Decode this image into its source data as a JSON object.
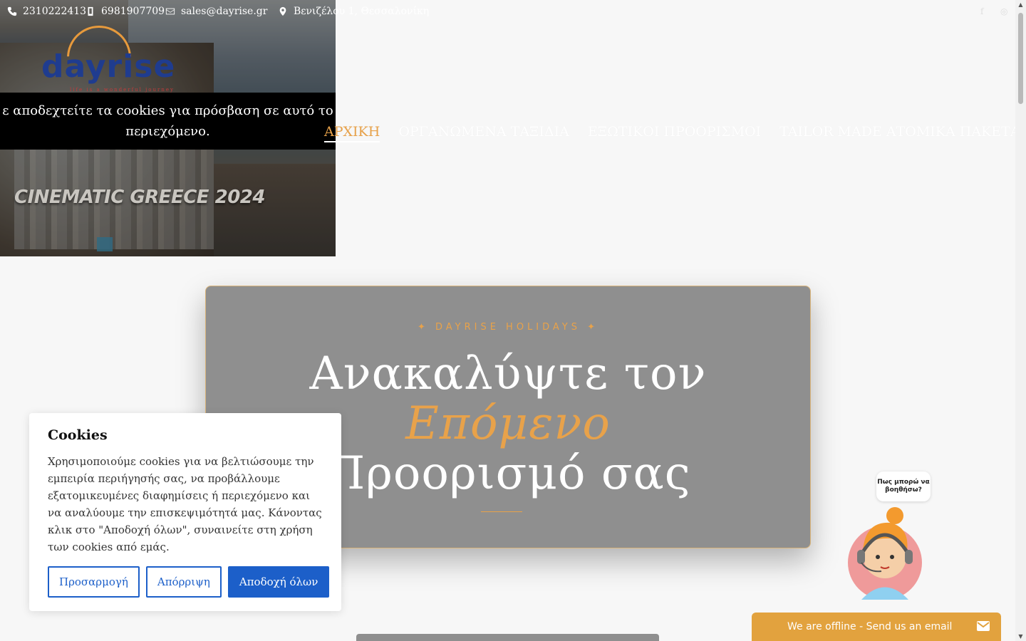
{
  "topbar": {
    "phone1": "2310222413",
    "phone2": "6981907709",
    "email": "sales@dayrise.gr",
    "address": "Βενιζέλου 1, Θεσσαλονίκη"
  },
  "logo": {
    "text": "dayrise",
    "tagline": "life is a wonderful journey"
  },
  "video": {
    "caption": "CINEMATIC GREECE 2024",
    "cookie_notice_line1": "ε αποδεχτείτε τα cookies για πρόσβαση σε αυτό το",
    "cookie_notice_line2": "περιεχόμενο."
  },
  "nav": {
    "items": [
      "ΑΡΧΙΚΗ",
      "ΟΡΓΑΝΩΜΕΝΑ ΤΑΞΙΔΙΑ",
      "ΕΞΩΤΙΚΟΙ ΠΡΟΟΡΙΣΜΟΙ",
      "TAILOR MADE ΑΤΟΜΙΚΑ ΠΑΚΕΤΑ"
    ],
    "active": "ΑΡΧΙΚΗ"
  },
  "hero": {
    "kicker": "✦ DAYRISE HOLIDAYS ✦",
    "line1": "Ανακαλύψτε τον",
    "line2": "Επόμενο",
    "line3": "Προορισμό σας"
  },
  "consent": {
    "title": "Cookies",
    "body": "Χρησιμοποιούμε cookies για να βελτιώσουμε την εμπειρία περιήγησής σας, να προβάλλουμε εξατομικευμένες διαφημίσεις ή περιεχόμενο και να αναλύουμε την επισκεψιμότητά μας. Κάνοντας κλικ στο \"Αποδοχή όλων\", συναινείτε στη χρήση των cookies από εμάς.",
    "customize": "Προσαρμογή",
    "reject": "Απόρριψη",
    "accept": "Αποδοχή όλων"
  },
  "chat": {
    "bubble": "Πως μπορώ να βοηθήσω?",
    "bar": "We are offline - Send us an email"
  },
  "colors": {
    "accent": "#e8a24a",
    "primary_button": "#1c5fc9",
    "hero_card": "#8f8f8f"
  }
}
